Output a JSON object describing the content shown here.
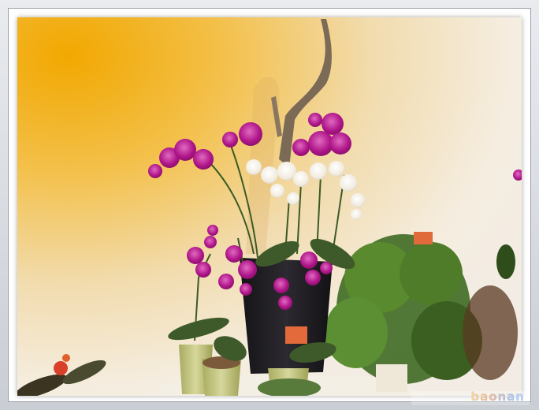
{
  "watermark": {
    "text": "baonan"
  },
  "price_tags": {
    "left": "",
    "right": ""
  },
  "colors": {
    "wall_warm": "#f3b21b",
    "wall_light": "#f6efe1",
    "orchid_magenta": "#b8168e",
    "orchid_white": "#f4efe6",
    "pot_dark": "#1e1d22",
    "pot_green": "#c8c985"
  }
}
